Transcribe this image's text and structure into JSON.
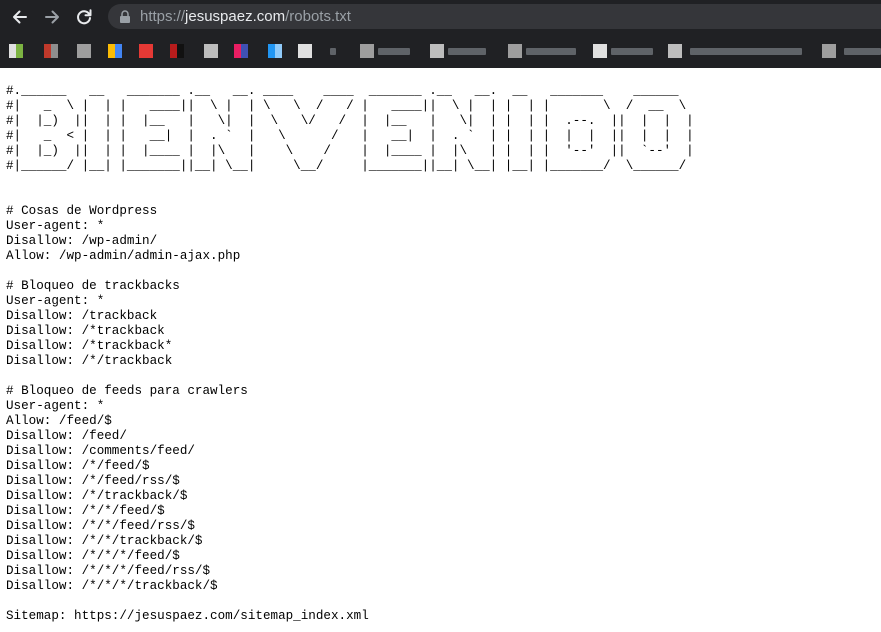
{
  "browser": {
    "url_scheme": "https://",
    "url_host": "jesuspaez.com",
    "url_path": "/robots.txt",
    "back_icon": "arrow-left-icon",
    "forward_icon": "arrow-right-icon",
    "reload_icon": "reload-icon",
    "lock_icon": "lock-icon"
  },
  "page": {
    "robots_txt": "#.______   __   _______ .__   __. ____    ____  _______ .__   __.  __   _______    ______ \n#|   _  \\ |  | |   ____||  \\ |  | \\   \\  /   / |   ____||  \\ |  | |  | |       \\  /  __  \\\n#|  |_)  ||  | |  |__   |   \\|  |  \\   \\/   /  |  |__   |   \\|  | |  | |  .--.  ||  |  |  |\n#|   _  < |  | |   __|  |  . `  |   \\      /   |   __|  |  . `  | |  | |  |  |  ||  |  |  |\n#|  |_)  ||  | |  |____ |  |\\   |    \\    /    |  |____ |  |\\   | |  | |  '--'  ||  `--'  |\n#|______/ |__| |_______||__| \\__|     \\__/     |_______||__| \\__| |__| |_______/  \\______/\n\n\n# Cosas de Wordpress\nUser-agent: *\nDisallow: /wp-admin/\nAllow: /wp-admin/admin-ajax.php\n\n# Bloqueo de trackbacks\nUser-agent: *\nDisallow: /trackback\nDisallow: /*trackback\nDisallow: /*trackback*\nDisallow: /*/trackback\n\n# Bloqueo de feeds para crawlers\nUser-agent: *\nAllow: /feed/$\nDisallow: /feed/\nDisallow: /comments/feed/\nDisallow: /*/feed/$\nDisallow: /*/feed/rss/$\nDisallow: /*/trackback/$\nDisallow: /*/*/feed/$\nDisallow: /*/*/feed/rss/$\nDisallow: /*/*/trackback/$\nDisallow: /*/*/*/feed/$\nDisallow: /*/*/*/feed/rss/$\nDisallow: /*/*/*/trackback/$\n\nSitemap: https://jesuspaez.com/sitemap_index.xml"
  },
  "colors": {
    "chrome_bg": "#202124",
    "omnibox_bg": "#35363a",
    "url_host": "#e8eaed",
    "url_dim": "#9aa0a6",
    "page_bg": "#ffffff",
    "text": "#000000"
  }
}
